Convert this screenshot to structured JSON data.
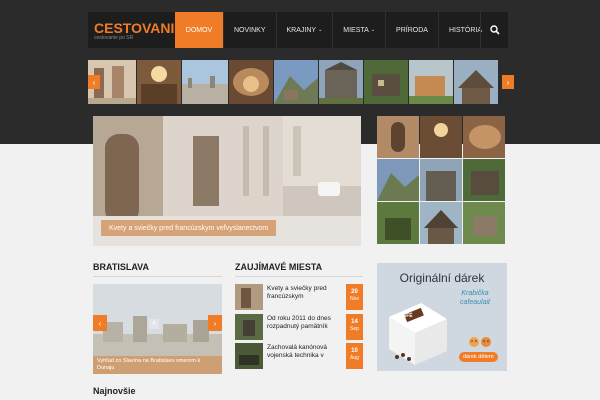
{
  "header": {
    "logo_title": "CESTOVANIE",
    "logo_subtitle": "cestovanie po SR",
    "nav": [
      {
        "label": "DOMOV",
        "active": true
      },
      {
        "label": "NOVINKY"
      },
      {
        "label": "KRAJINY",
        "caret": "⌄"
      },
      {
        "label": "MIESTA",
        "caret": "⌄"
      },
      {
        "label": "PRÍRODA"
      },
      {
        "label": "HISTÓRIA"
      }
    ],
    "search_icon": "search-icon"
  },
  "strip": {
    "prev_icon": "‹",
    "next_icon": "›"
  },
  "hero": {
    "caption": "Kvety a sviečky pred francúzskym veľvyslanectvom"
  },
  "sections": {
    "bratislava": "BRATISLAVA",
    "zaujimave": "ZAUJÍMAVÉ MIESTA",
    "najnovsie": "Najnovšie"
  },
  "bratislava_slide": {
    "caption": "Vyhľad zo Slavína na Bratislavu smerom k Dunaju",
    "prev_icon": "‹",
    "next_icon": "›",
    "center_icon": "4"
  },
  "news": [
    {
      "title": "Kvety a sviečky pred francúzskym",
      "day": "20",
      "month": "Nov"
    },
    {
      "title": "Od roku 2011 do dnes rozpadnutý pamätník",
      "day": "14",
      "month": "Sep"
    },
    {
      "title": "Zachovalá kanónová vojenská technika v",
      "day": "10",
      "month": "Aug"
    }
  ],
  "ad": {
    "title": "Originální dárek",
    "sub1": "Krabička",
    "sub2": "cafeaulait",
    "box_label": "CAFÉ",
    "button": "dárek dětem"
  },
  "colors": {
    "accent": "#f07c27",
    "dark": "#2b2b2b"
  }
}
